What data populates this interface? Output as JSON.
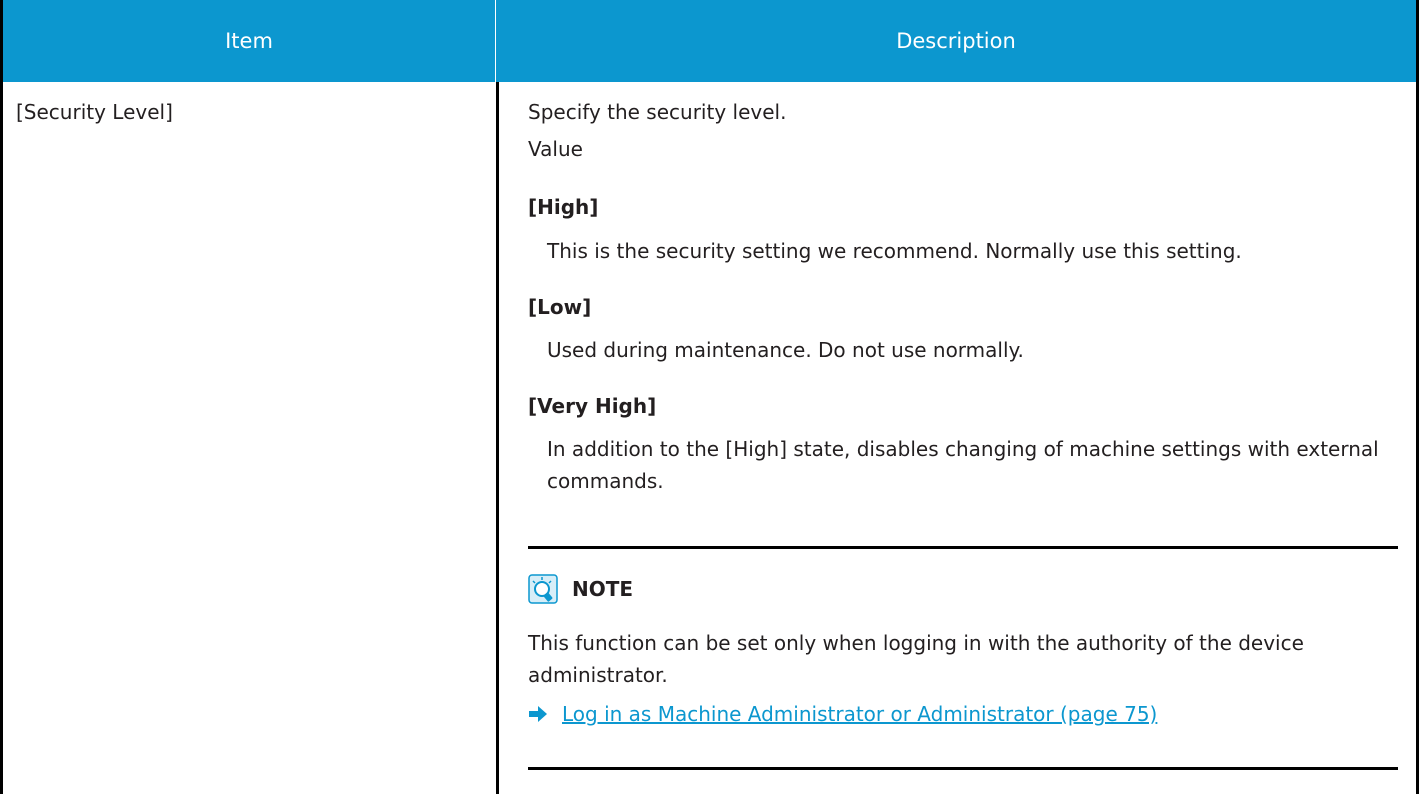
{
  "table": {
    "header": {
      "item": "Item",
      "description": "Description"
    },
    "row": {
      "item": "[Security Level]",
      "description_intro": "Specify the security level.",
      "value_label": "Value",
      "options": [
        {
          "label": "[High]",
          "text": "This is the security setting we recommend. Normally use this setting."
        },
        {
          "label": "[Low]",
          "text": "Used during maintenance. Do not use normally."
        },
        {
          "label": "[Very High]",
          "text": "In addition to the [High] state, disables changing of machine settings with external commands."
        }
      ],
      "note": {
        "title": "NOTE",
        "icon": "lightbulb-icon",
        "text": "This function can be set only when logging in with the authority of the device administrator.",
        "link_icon": "arrow-right-icon",
        "link_text": "Log in as Machine Administrator or Administrator (page 75)"
      }
    }
  },
  "colors": {
    "header_bg": "#0c97cf",
    "link": "#0c97cf",
    "text": "#231f20"
  }
}
